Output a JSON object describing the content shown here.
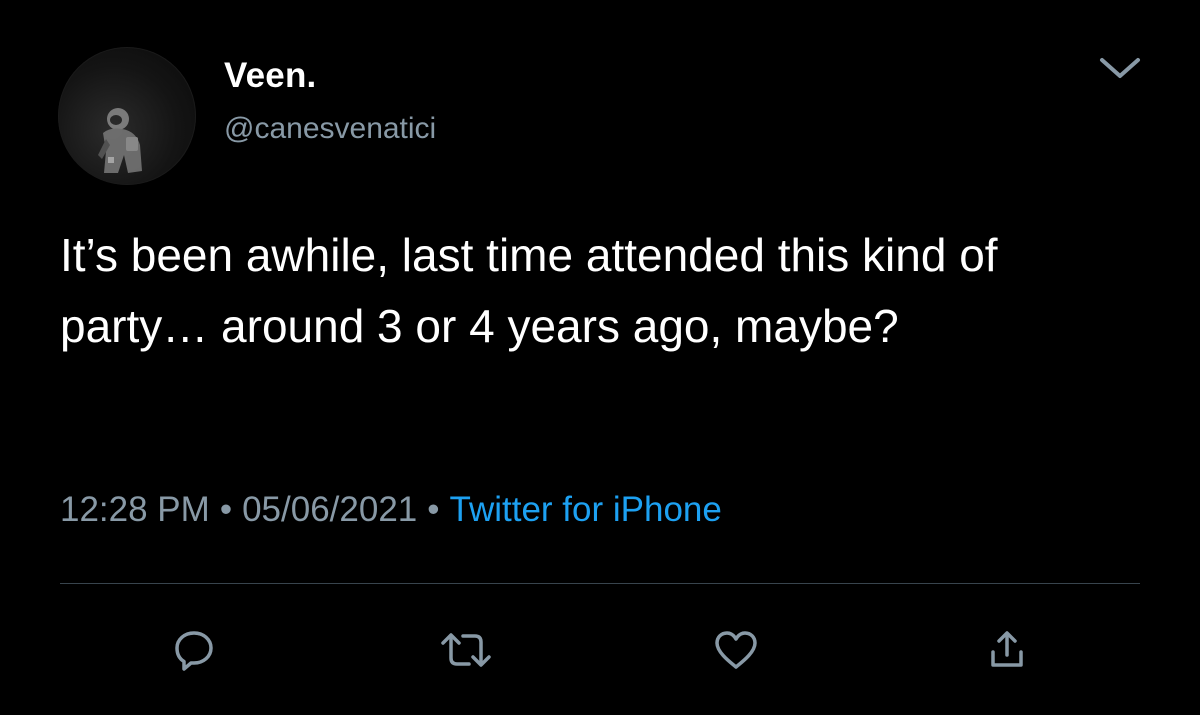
{
  "tweet": {
    "author": {
      "display_name": "Veen.",
      "handle": "@canesvenatici"
    },
    "text": "It’s been awhile, last time attended this kind of party… around 3 or 4 years ago, maybe?",
    "time": "12:28 PM",
    "date": "05/06/2021",
    "separator": "•",
    "source": "Twitter for iPhone"
  },
  "icons": {
    "menu": "chevron-down-icon",
    "reply": "reply-icon",
    "retweet": "retweet-icon",
    "like": "heart-icon",
    "share": "share-icon"
  },
  "colors": {
    "background": "#000000",
    "primary_text": "#ffffff",
    "secondary_text": "#8899a6",
    "link": "#1da1f2",
    "divider": "#38444d"
  }
}
